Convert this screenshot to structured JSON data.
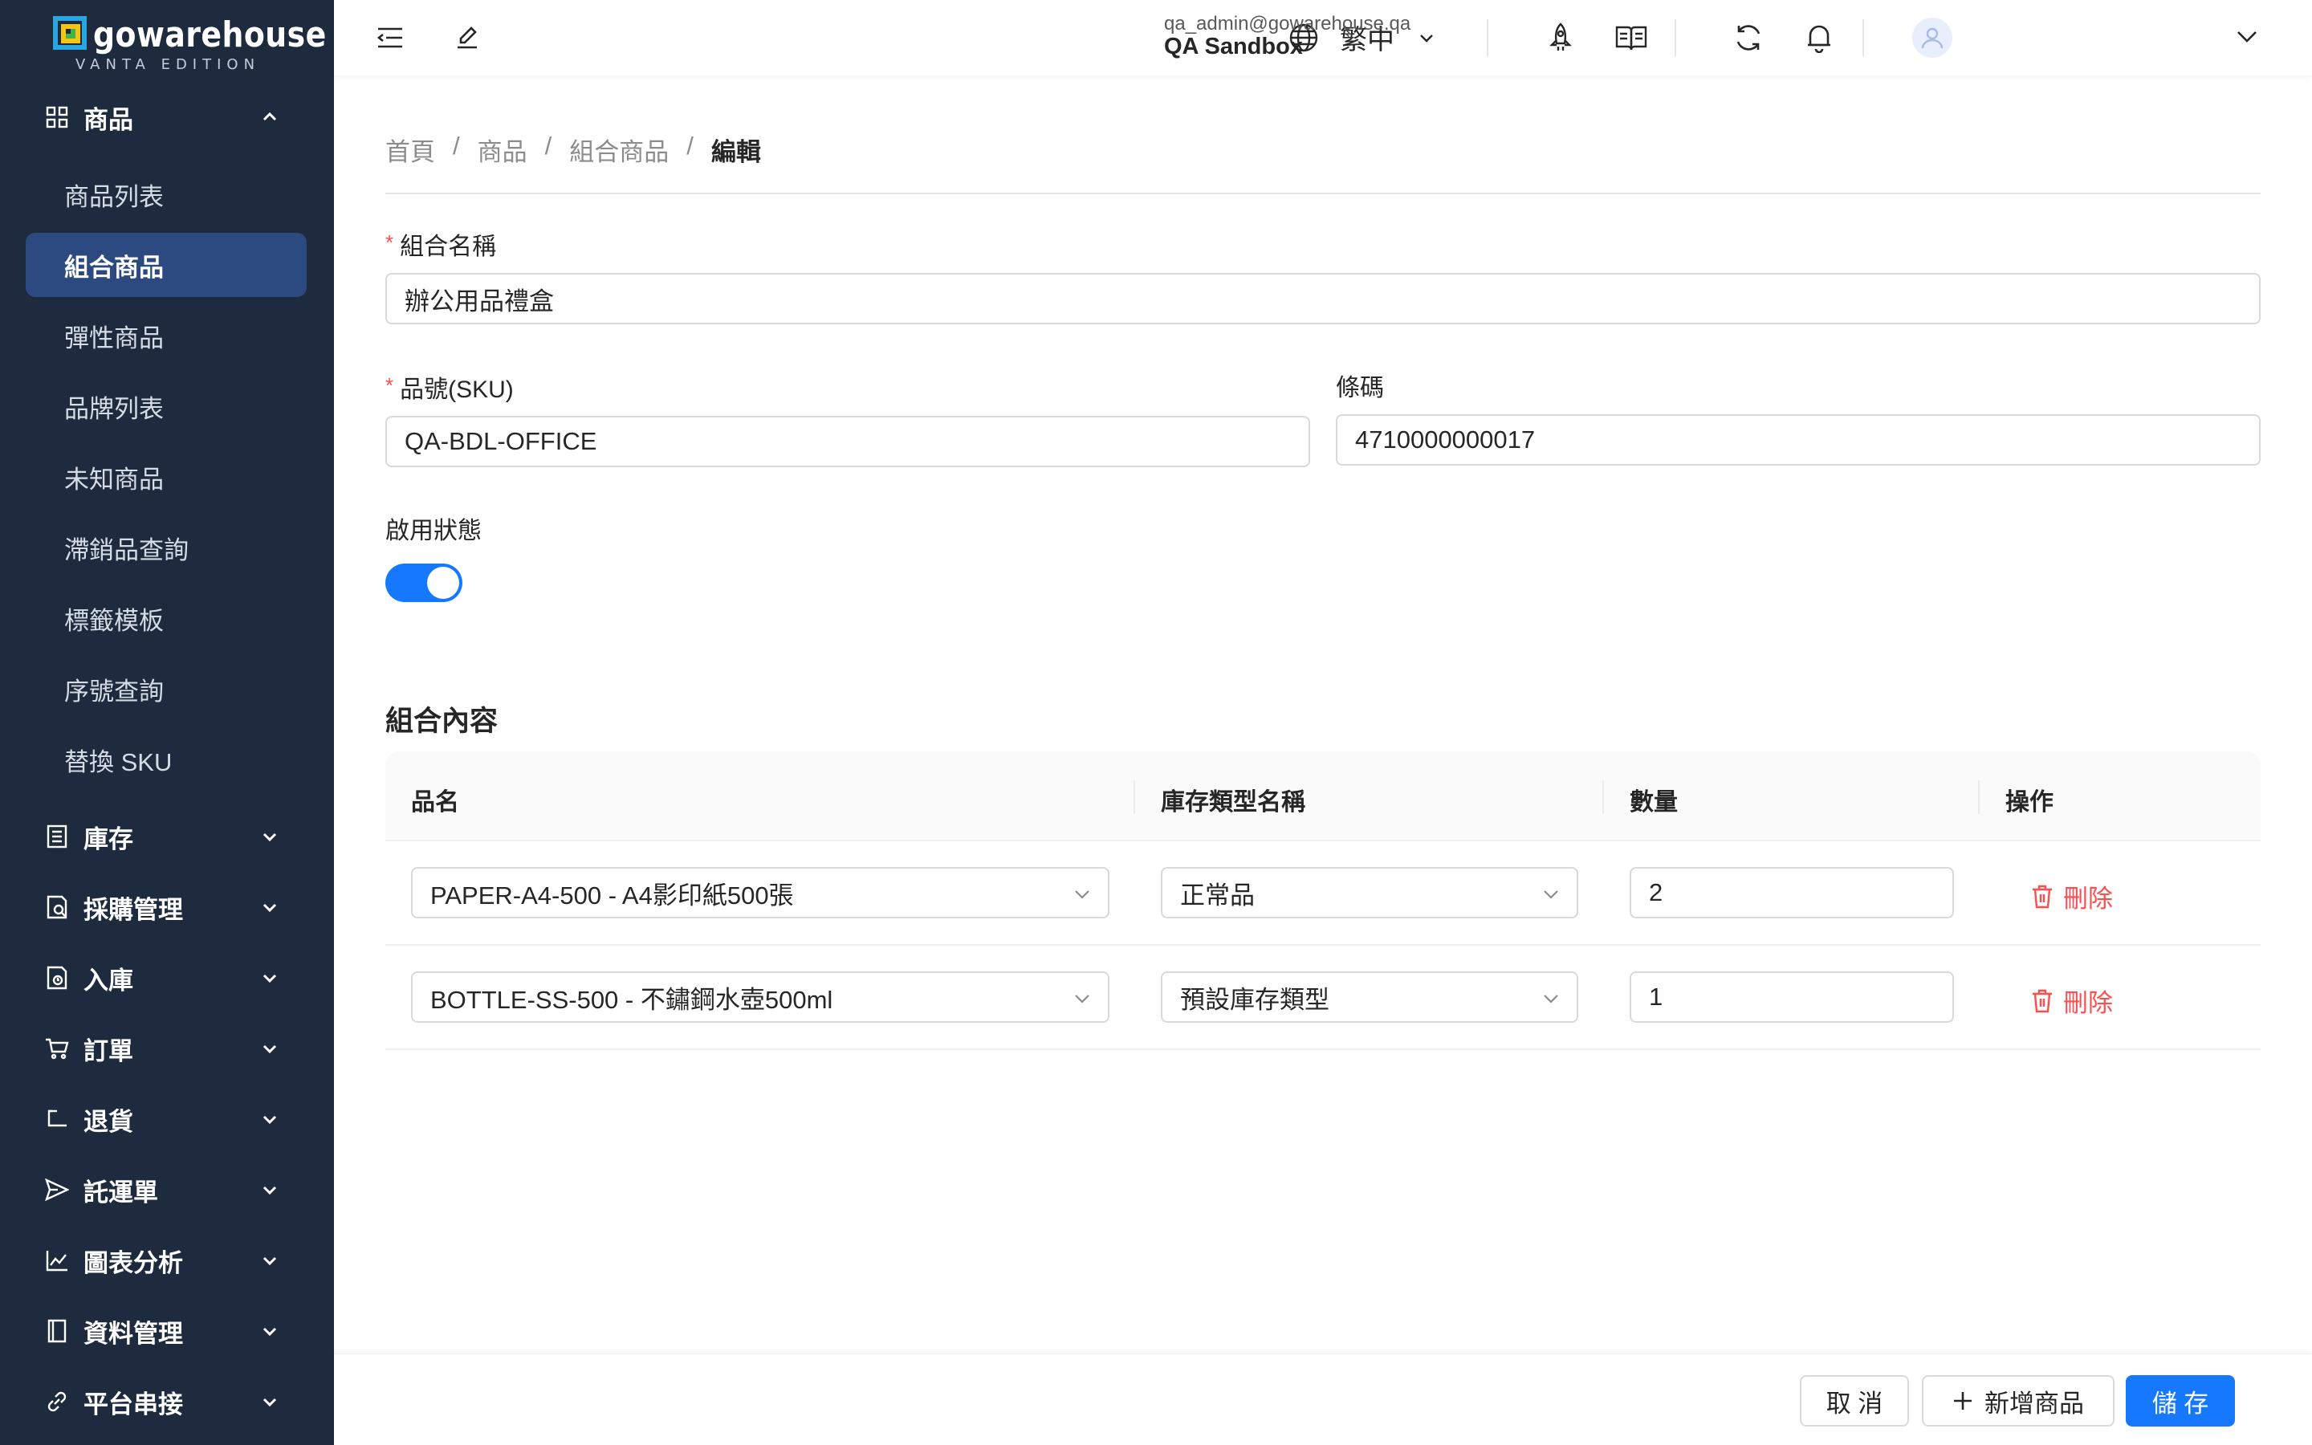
{
  "brand": {
    "name": "gowarehouse",
    "edition": "VANTA EDITION",
    "colors": {
      "sidebar": "#1e2b3f",
      "active": "#2c4a7f",
      "primary": "#1677ff",
      "danger": "#ff4d4f"
    }
  },
  "sidebar": {
    "product_group": {
      "label": "商品",
      "icon": "grid-icon",
      "expanded": true
    },
    "product_items": [
      {
        "label": "商品列表",
        "active": false
      },
      {
        "label": "組合商品",
        "active": true
      },
      {
        "label": "彈性商品",
        "active": false
      },
      {
        "label": "品牌列表",
        "active": false
      },
      {
        "label": "未知商品",
        "active": false
      },
      {
        "label": "滯銷品查詢",
        "active": false
      },
      {
        "label": "標籤模板",
        "active": false
      },
      {
        "label": "序號查詢",
        "active": false
      },
      {
        "label": "替換 SKU",
        "active": false
      }
    ],
    "groups": [
      {
        "label": "庫存",
        "icon": "inventory-icon"
      },
      {
        "label": "採購管理",
        "icon": "purchase-icon"
      },
      {
        "label": "入庫",
        "icon": "inbound-icon"
      },
      {
        "label": "訂單",
        "icon": "cart-icon"
      },
      {
        "label": "退貨",
        "icon": "return-icon"
      },
      {
        "label": "託運單",
        "icon": "send-icon"
      },
      {
        "label": "圖表分析",
        "icon": "chart-icon"
      },
      {
        "label": "資料管理",
        "icon": "book-icon"
      },
      {
        "label": "平台串接",
        "icon": "link-icon"
      }
    ]
  },
  "header": {
    "language": "繁中",
    "user_email": "qa_admin@gowarehouse.qa",
    "user_org": "QA Sandbox"
  },
  "breadcrumb": [
    "首頁",
    "商品",
    "組合商品",
    "編輯"
  ],
  "form": {
    "name_label": "組合名稱",
    "name_value": "辦公用品禮盒",
    "sku_label": "品號(SKU)",
    "sku_value": "QA-BDL-OFFICE",
    "barcode_label": "條碼",
    "barcode_value": "4710000000017",
    "status_label": "啟用狀態",
    "status_on": true
  },
  "contents": {
    "title": "組合內容",
    "columns": [
      "品名",
      "庫存類型名稱",
      "數量",
      "操作"
    ],
    "rows": [
      {
        "product": "PAPER-A4-500 - A4影印紙500張",
        "stock_type": "正常品",
        "qty": "2",
        "action": "刪除"
      },
      {
        "product": "BOTTLE-SS-500 - 不鏽鋼水壺500ml",
        "stock_type": "預設庫存類型",
        "qty": "1",
        "action": "刪除"
      }
    ]
  },
  "footer": {
    "cancel": "取 消",
    "add_product": "新增商品",
    "save": "儲 存"
  }
}
